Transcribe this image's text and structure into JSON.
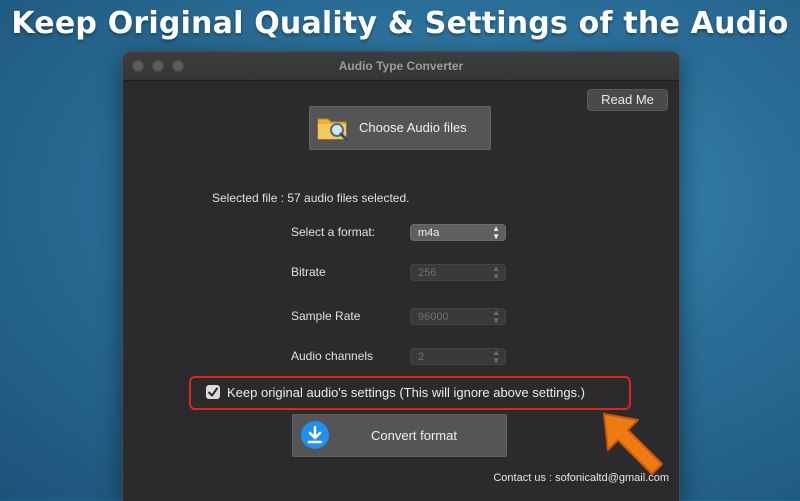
{
  "headline": "Keep Original Quality & Settings of the Audio",
  "window": {
    "title": "Audio Type Converter",
    "read_me_label": "Read Me",
    "choose_label": "Choose Audio files",
    "selected_file_text": "Selected file : 57 audio files selected.",
    "format": {
      "label": "Select a format:",
      "value": "m4a"
    },
    "bitrate": {
      "label": "Bitrate",
      "value": "256"
    },
    "sample_rate": {
      "label": "Sample Rate",
      "value": "96000"
    },
    "channels": {
      "label": "Audio channels",
      "value": "2"
    },
    "keep_original": {
      "label": "Keep original audio's settings (This will ignore above settings.)",
      "checked": true
    },
    "convert_label": "Convert format",
    "contact_text": "Contact us : sofonicaltd@gmail.com"
  },
  "colors": {
    "accent_blue": "#1f8ff0",
    "highlight_red": "#e0261c",
    "arrow_orange": "#f07a12"
  },
  "icons": [
    "folder-search-icon",
    "download-icon",
    "checkmark-icon",
    "pointer-arrow-icon"
  ]
}
